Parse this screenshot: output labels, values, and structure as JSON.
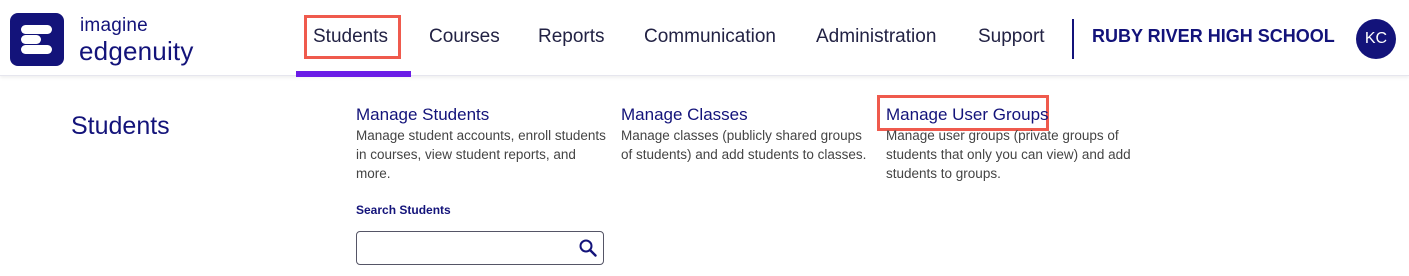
{
  "brand": {
    "line1": "imagine",
    "line2": "edgenuity",
    "color": "#13137a"
  },
  "nav": {
    "items": [
      {
        "label": "Students",
        "active": true
      },
      {
        "label": "Courses"
      },
      {
        "label": "Reports"
      },
      {
        "label": "Communication"
      },
      {
        "label": "Administration"
      },
      {
        "label": "Support"
      }
    ],
    "active_underline_color": "#6a1be6",
    "highlight_color": "#ef5a4d"
  },
  "school": {
    "name": "RUBY RIVER HIGH SCHOOL"
  },
  "user": {
    "initials": "KC"
  },
  "panel": {
    "title": "Students",
    "columns": [
      {
        "link": "Manage Students",
        "description": "Manage student accounts, enroll students in courses, view student reports, and more."
      },
      {
        "link": "Manage Classes",
        "description": "Manage classes (publicly shared groups of students) and add students to classes."
      },
      {
        "link": "Manage User Groups",
        "description": "Manage user groups (private groups of students that only you can view) and add students to groups."
      }
    ],
    "search": {
      "label": "Search Students",
      "value": "",
      "icon": "search-icon"
    }
  }
}
